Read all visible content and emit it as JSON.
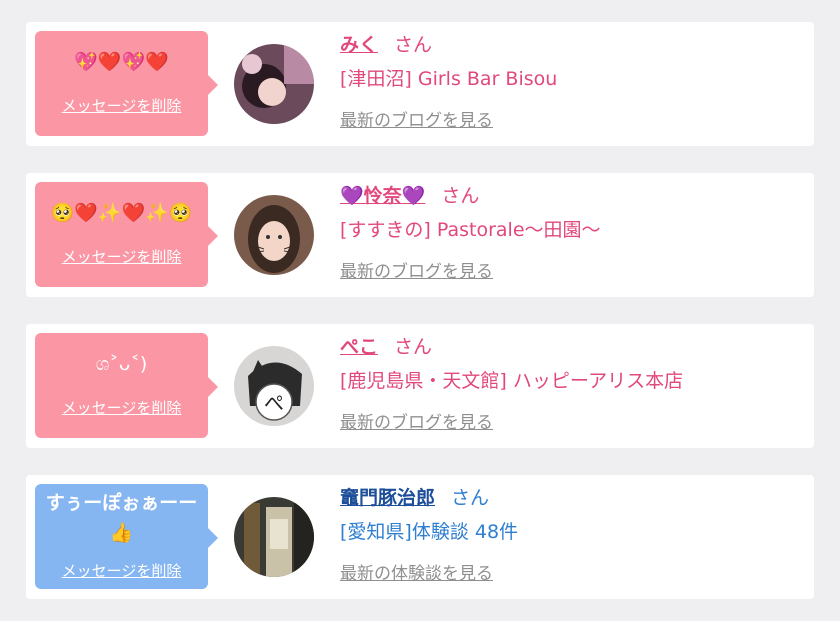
{
  "messages": [
    {
      "bubble_text": "💖❤️💖❤️",
      "delete_label": "メッセージを削除",
      "name": "みく",
      "honorific": "さん",
      "store": "[津田沼] Girls Bar Bisou",
      "link": "最新のブログを見る",
      "theme": "pink"
    },
    {
      "bubble_text": "🥺❤️✨❤️✨🥺",
      "delete_label": "メッセージを削除",
      "name": "💜怜奈💜",
      "honorific": "さん",
      "store": "[すすきの] Pastorale〜田園〜",
      "link": "最新のブログを見る",
      "theme": "pink"
    },
    {
      "bubble_text": "ශ˃ᴗ˂)",
      "delete_label": "メッセージを削除",
      "name": "ぺこ",
      "honorific": "さん",
      "store": "[鹿児島県・天文館] ハッピーアリス本店",
      "link": "最新のブログを見る",
      "theme": "pink"
    },
    {
      "bubble_text": "すぅーぽぉぁーー\n👍",
      "delete_label": "メッセージを削除",
      "name": "竈門豚治郎",
      "honorific": "さん",
      "store": "[愛知県]体験談 48件",
      "link": "最新の体験談を見る",
      "theme": "blue"
    }
  ],
  "colors": {
    "pink_bubble": "#fb97a5",
    "blue_bubble": "#86b6f2",
    "pink_text": "#e1487d",
    "blue_text": "#2f7fd0",
    "link_gray": "#8f8f8f",
    "background": "#efeff1"
  }
}
